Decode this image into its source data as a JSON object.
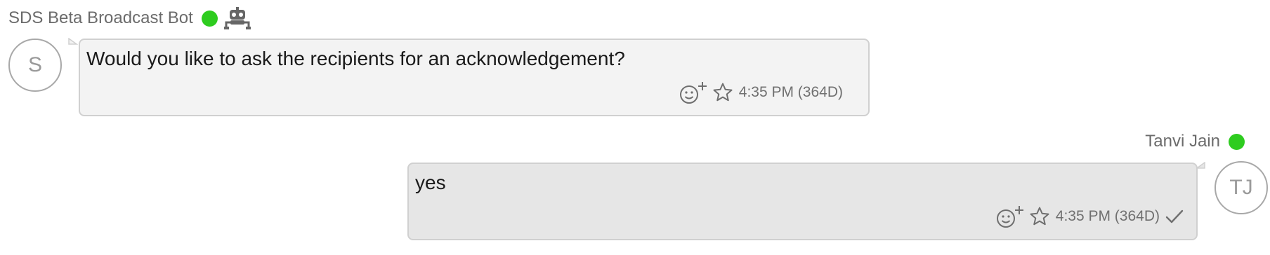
{
  "colors": {
    "online": "#2ecc1f",
    "bubble_in": "#f3f3f3",
    "bubble_out": "#e6e6e6",
    "border": "#d0d0d0",
    "muted": "#707070"
  },
  "messages": [
    {
      "sender": "SDS Beta Broadcast Bot",
      "status": "online",
      "is_bot": true,
      "avatar_initials": "S",
      "text": "Would you like to ask the recipients for an acknowledgement?",
      "timestamp": "4:35 PM (364D)",
      "icons": [
        "add-reaction-icon",
        "star-icon"
      ]
    },
    {
      "sender": "Tanvi Jain",
      "status": "online",
      "is_bot": false,
      "avatar_initials": "TJ",
      "text": "yes",
      "timestamp": "4:35 PM (364D)",
      "delivered": true,
      "icons": [
        "add-reaction-icon",
        "star-icon",
        "check-icon"
      ]
    }
  ]
}
